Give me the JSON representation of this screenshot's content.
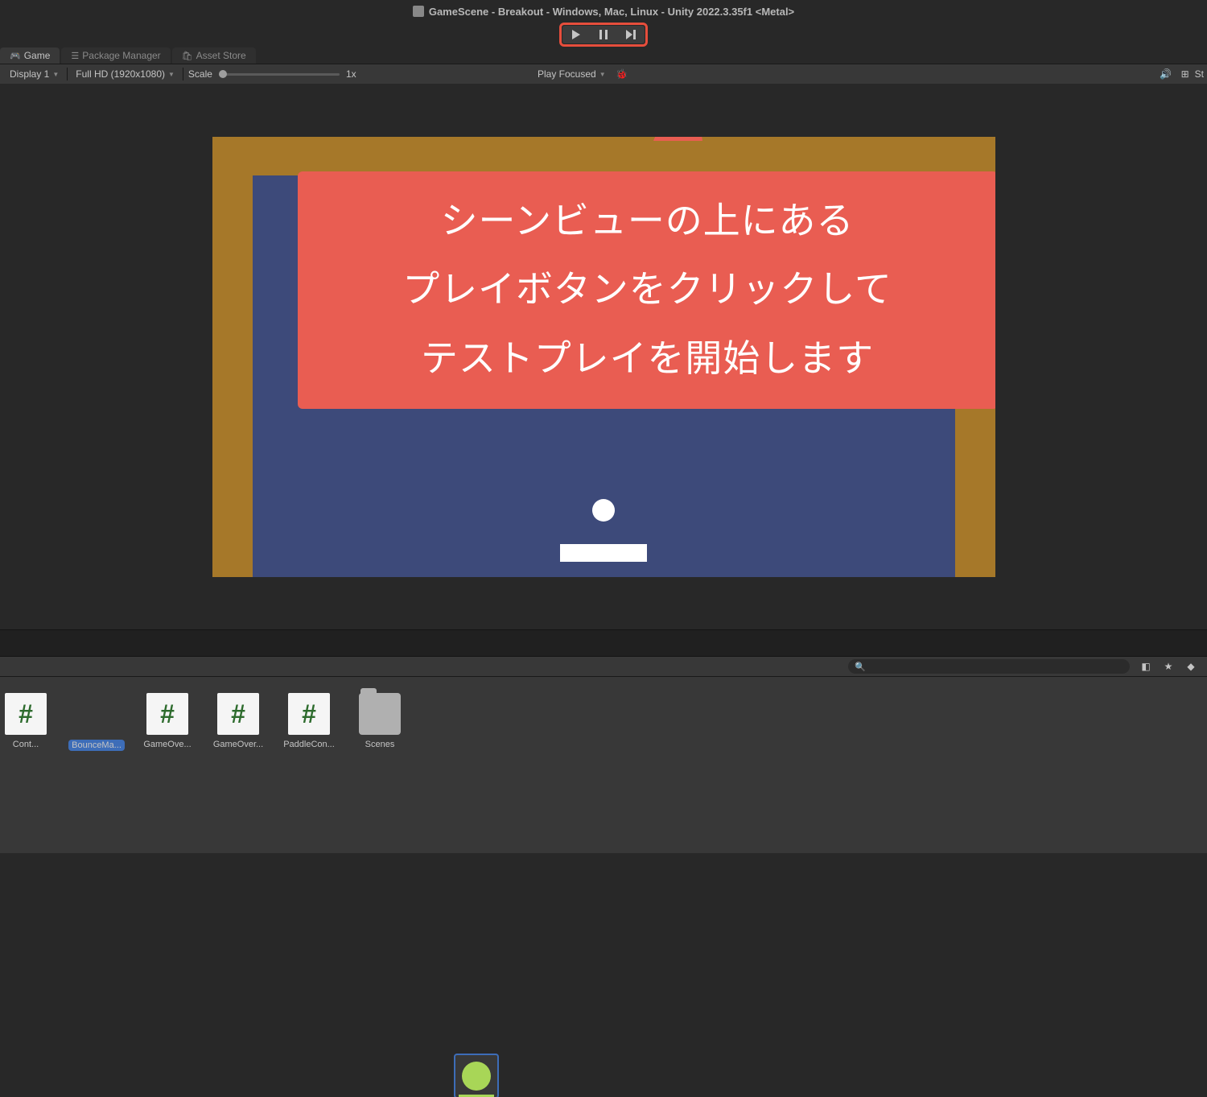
{
  "title_bar": {
    "title": "GameScene - Breakout - Windows, Mac, Linux - Unity 2022.3.35f1 <Metal>"
  },
  "tabs": [
    {
      "label": "Game",
      "icon": "🎮",
      "active": true
    },
    {
      "label": "Package Manager",
      "icon": "📦",
      "active": false
    },
    {
      "label": "Asset Store",
      "icon": "🛒",
      "active": false
    }
  ],
  "toolbar": {
    "display": "Display 1",
    "resolution": "Full HD (1920x1080)",
    "scale_label": "Scale",
    "scale_value": "1x",
    "play_focused": "Play Focused",
    "stats": "St"
  },
  "callout": {
    "line1": "シーンビューの上にある",
    "line2": "プレイボタンをクリックして",
    "line3": "テストプレイを開始します"
  },
  "search": {
    "placeholder": ""
  },
  "assets": [
    {
      "type": "script",
      "label": "Cont..."
    },
    {
      "type": "ball",
      "label": "BounceMa..."
    },
    {
      "type": "script",
      "label": "GameOve..."
    },
    {
      "type": "script",
      "label": "GameOver..."
    },
    {
      "type": "script",
      "label": "PaddleCon..."
    },
    {
      "type": "folder",
      "label": "Scenes"
    }
  ]
}
